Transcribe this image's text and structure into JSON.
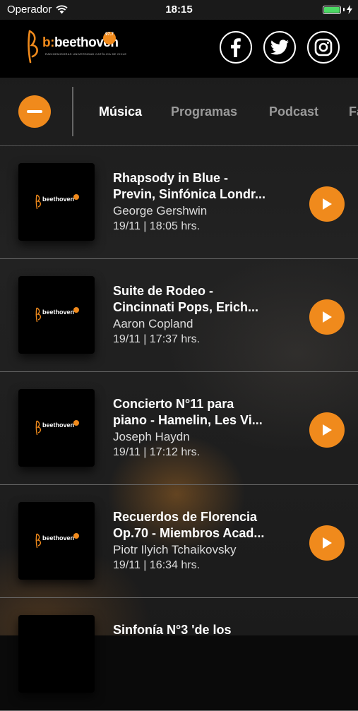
{
  "status_bar": {
    "carrier": "Operador",
    "time": "18:15",
    "colors": {
      "battery": "#4cd964"
    }
  },
  "header": {
    "logo": {
      "prefix": "b:",
      "word": "beethoven",
      "frequency": "97.7",
      "tagline": "RADIOEMISORAS UNIVERSIDAD CATÓLICA DE CHILE"
    },
    "social": [
      {
        "icon": "facebook-icon"
      },
      {
        "icon": "twitter-icon"
      },
      {
        "icon": "instagram-icon"
      }
    ]
  },
  "tabs": {
    "menu_icon": "minus-icon",
    "items": [
      {
        "label": "Música",
        "active": true
      },
      {
        "label": "Programas",
        "active": false
      },
      {
        "label": "Podcast",
        "active": false
      },
      {
        "label": "Fa",
        "active": false
      }
    ]
  },
  "list": [
    {
      "title_line1": "Rhapsody in Blue -",
      "title_line2": "Previn, Sinfónica Londr...",
      "artist": "George Gershwin",
      "date": "19/11 | 18:05 hrs."
    },
    {
      "title_line1": "Suite de Rodeo -",
      "title_line2": "Cincinnati Pops, Erich...",
      "artist": "Aaron Copland",
      "date": "19/11 | 17:37 hrs."
    },
    {
      "title_line1": "Concierto N°11 para",
      "title_line2": "piano - Hamelin, Les Vi...",
      "artist": "Joseph Haydn",
      "date": "19/11 | 17:12 hrs."
    },
    {
      "title_line1": "Recuerdos de Florencia",
      "title_line2": "Op.70 - Miembros Acad...",
      "artist": "Piotr Ilyich Tchaikovsky",
      "date": "19/11 | 16:34 hrs."
    },
    {
      "title_line1": "Sinfonía N°3 'de los",
      "title_line2": "",
      "artist": "",
      "date": ""
    }
  ],
  "colors": {
    "accent": "#f08a1c",
    "header_bg": "#000000"
  }
}
